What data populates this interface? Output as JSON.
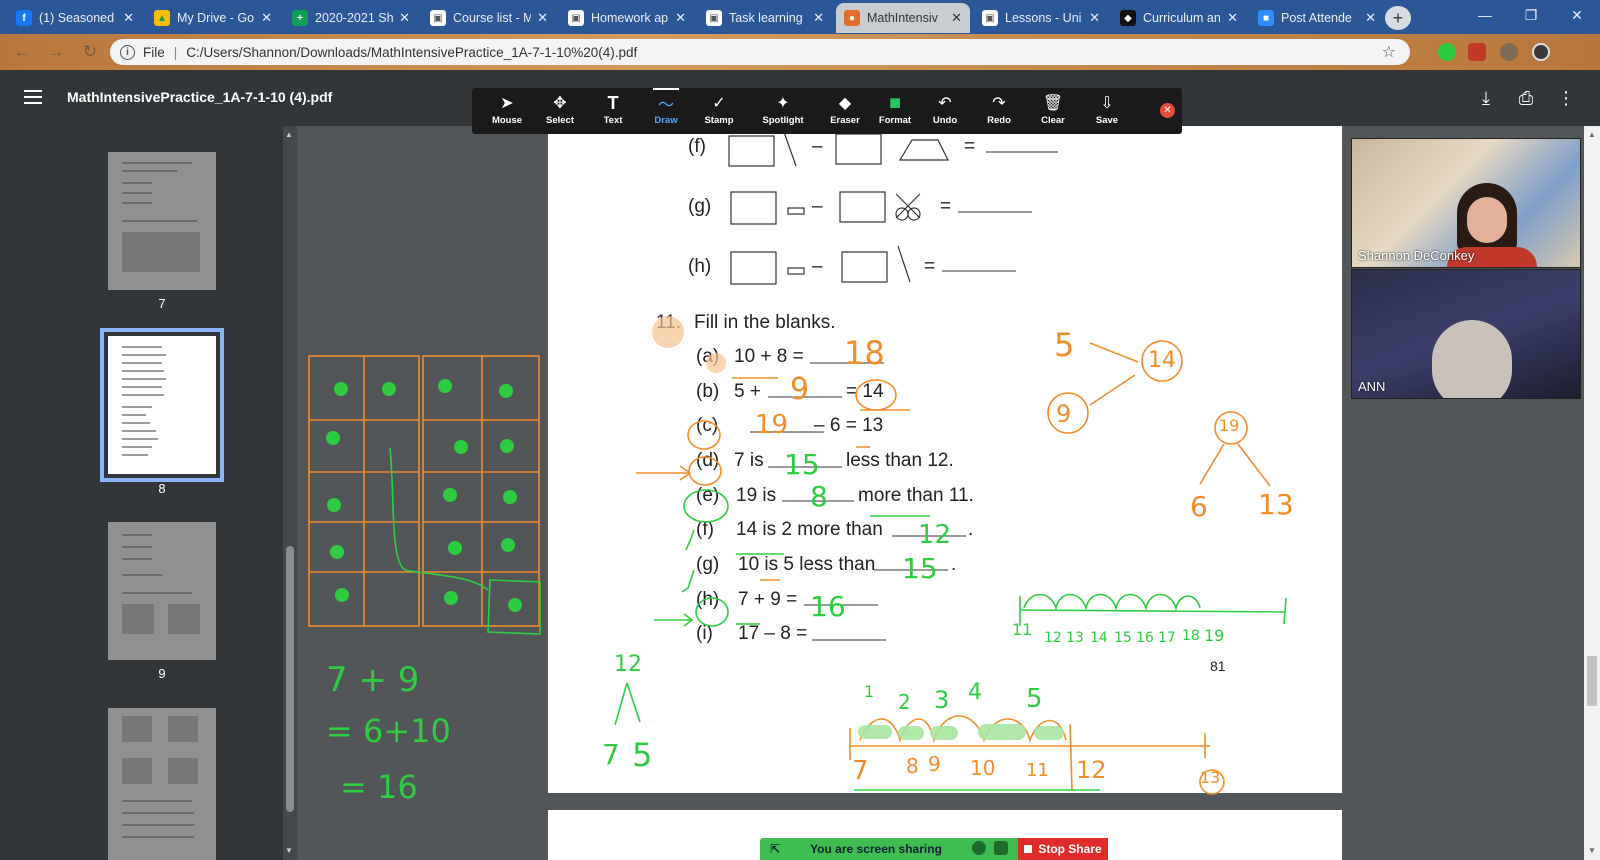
{
  "browser": {
    "tabs": [
      {
        "title": "(1) Seasoned",
        "color": "#1877f2",
        "glyph": "f"
      },
      {
        "title": "My Drive - Go",
        "color": "#fbbc04",
        "glyph": "▲"
      },
      {
        "title": "2020-2021 Sh",
        "color": "#0f9d58",
        "glyph": "+"
      },
      {
        "title": "Course list - M",
        "color": "#ffffff",
        "glyph": "▣"
      },
      {
        "title": "Homework ap",
        "color": "#ffffff",
        "glyph": "▣"
      },
      {
        "title": "Task learning",
        "color": "#ffffff",
        "glyph": "▣"
      },
      {
        "title": "MathIntensiv",
        "color": "#e06c2e",
        "glyph": "●"
      },
      {
        "title": "Lessons - Uni",
        "color": "#ffffff",
        "glyph": "▣"
      },
      {
        "title": "Curriculum an",
        "color": "#111111",
        "glyph": "◆"
      },
      {
        "title": "Post Attende",
        "color": "#2d8cff",
        "glyph": "■"
      }
    ],
    "address": {
      "scheme_label": "File",
      "url": "C:/Users/Shannon/Downloads/MathIntensivePractice_1A-7-1-10%20(4).pdf"
    }
  },
  "viewer": {
    "title": "MathIntensivePractice_1A-7-1-10 (4).pdf"
  },
  "toolbar": {
    "tools": [
      {
        "label": "Mouse",
        "icon": "➤"
      },
      {
        "label": "Select",
        "icon": "✥"
      },
      {
        "label": "Text",
        "icon": "T"
      },
      {
        "label": "Draw",
        "icon": "〜"
      },
      {
        "label": "Stamp",
        "icon": "✓"
      },
      {
        "label": "Spotlight",
        "icon": "✦"
      },
      {
        "label": "Eraser",
        "icon": "◆"
      },
      {
        "label": "Format",
        "icon": "■"
      },
      {
        "label": "Undo",
        "icon": "↶"
      },
      {
        "label": "Redo",
        "icon": "↷"
      },
      {
        "label": "Clear",
        "icon": "🗑"
      },
      {
        "label": "Save",
        "icon": "⇩"
      }
    ],
    "active_tool": "Draw",
    "format_color": "#22c55e"
  },
  "sidebar": {
    "pages": [
      "7",
      "8",
      "9"
    ],
    "selected_page": "8"
  },
  "worksheet": {
    "rows_top": [
      {
        "label": "(f)",
        "equals": "="
      },
      {
        "label": "(g)",
        "equals": "="
      },
      {
        "label": "(h)",
        "equals": "="
      }
    ],
    "minus": "–",
    "question_num": "11.",
    "question_text": "Fill in the blanks.",
    "items": [
      {
        "label": "(a)",
        "before": "10 + 8 =",
        "after": ""
      },
      {
        "label": "(b)",
        "before": "5 +",
        "after": "= 14"
      },
      {
        "label": "(c)",
        "before": "",
        "after": "– 6 = 13"
      },
      {
        "label": "(d)",
        "before": "7 is",
        "after": "less than 12."
      },
      {
        "label": "(e)",
        "before": "19 is",
        "after": "more than 11."
      },
      {
        "label": "(f)",
        "before": "14 is 2 more than",
        "after": "."
      },
      {
        "label": "(g)",
        "before": "10 is 5 less than",
        "after": "."
      },
      {
        "label": "(h)",
        "before": "7 + 9 =",
        "after": ""
      },
      {
        "label": "(i)",
        "before": "17 – 8 =",
        "after": ""
      }
    ],
    "page_number": "81"
  },
  "handwriting": {
    "answers": [
      "18",
      "9",
      "19",
      "15",
      "8",
      "12",
      "15",
      "16"
    ],
    "side_work": [
      "7 + 9",
      "= 6+10",
      "= 16"
    ],
    "bond_left": [
      "5",
      "14",
      "9"
    ],
    "bond_right": [
      "19",
      "6",
      "13"
    ],
    "bond_bottom": [
      "12",
      "7",
      "5"
    ],
    "green_line_labels": [
      "11",
      "12",
      "13",
      "14",
      "15",
      "16",
      "17",
      "18",
      "19"
    ],
    "orange_line_labels": [
      "7",
      "8",
      "9",
      "10",
      "11",
      "12",
      "13"
    ],
    "hop_counts": [
      "1",
      "2",
      "3",
      "4",
      "5"
    ]
  },
  "participants": [
    {
      "name": "Shannon DeConkey"
    },
    {
      "name": "ANN"
    }
  ],
  "sharing": {
    "status": "You are screen sharing",
    "stop_label": "Stop Share",
    "bar_color": "#3fbd52",
    "stop_color": "#e02b2b"
  },
  "ink_colors": {
    "orange": "#f28c28",
    "green": "#2ecc40"
  }
}
